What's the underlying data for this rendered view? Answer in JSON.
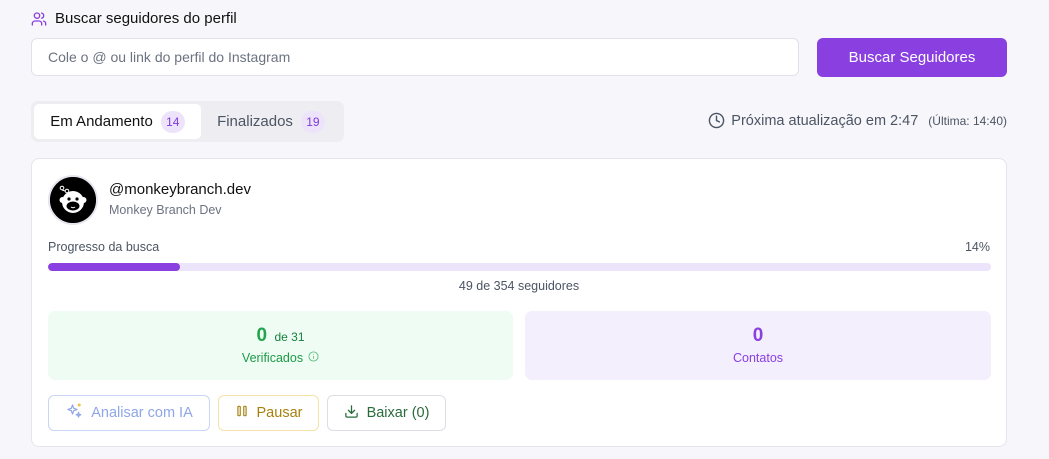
{
  "header": {
    "title": "Buscar seguidores do perfil",
    "icon": "users-icon"
  },
  "search": {
    "placeholder": "Cole o @ ou link do perfil do Instagram",
    "value": "",
    "button_label": "Buscar Seguidores"
  },
  "tabs": [
    {
      "label": "Em Andamento",
      "count": "14",
      "active": true
    },
    {
      "label": "Finalizados",
      "count": "19",
      "active": false
    }
  ],
  "update": {
    "next": "Próxima atualização em 2:47",
    "last": "(Última: 14:40)"
  },
  "profile": {
    "handle": "@monkeybranch.dev",
    "name": "Monkey Branch Dev",
    "progress_label": "Progresso da busca",
    "progress_percent_text": "14%",
    "progress": 0.14,
    "count_text": "49 de 354 seguidores",
    "verified": {
      "value": "0",
      "of": "de 31",
      "label": "Verificados"
    },
    "contacts": {
      "value": "0",
      "label": "Contatos"
    },
    "actions": {
      "analyze": "Analisar com IA",
      "pause": "Pausar",
      "download": "Baixar (0)"
    }
  },
  "colors": {
    "accent": "#8a3fe0",
    "success": "#22a34d",
    "warning": "#a8810d"
  }
}
